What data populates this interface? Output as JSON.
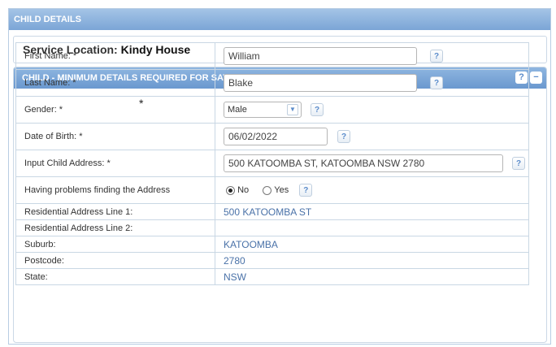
{
  "header": {
    "title": "CHILD DETAILS"
  },
  "service": {
    "label": "Service Location:",
    "value": "Kindy House"
  },
  "section": {
    "title": "CHILD - MINIMUM DETAILS REQUIRED FOR SAVING",
    "help_label": "?",
    "collapse_label": "−"
  },
  "fields": {
    "first_name": {
      "label": "First Name: *",
      "value": "William"
    },
    "last_name": {
      "label": "Last Name: *",
      "value": "Blake"
    },
    "gender": {
      "label": "Gender: *",
      "value": "Male"
    },
    "dob": {
      "label": "Date of Birth: *",
      "value": "06/02/2022"
    },
    "address": {
      "label": "Input Child Address: *",
      "value": "500 KATOOMBA ST, KATOOMBA NSW 2780"
    },
    "problems": {
      "label": "Having problems finding the Address",
      "no": "No",
      "yes": "Yes",
      "selected": "No"
    },
    "addr1": {
      "label": "Residential Address Line 1:",
      "value": "500 KATOOMBA ST"
    },
    "addr2": {
      "label": "Residential Address Line 2:",
      "value": ""
    },
    "suburb": {
      "label": "Suburb:",
      "value": "KATOOMBA"
    },
    "postcode": {
      "label": "Postcode:",
      "value": "2780"
    },
    "state": {
      "label": "State:",
      "value": "NSW"
    }
  },
  "help_text": "?",
  "stray_mark": "*"
}
